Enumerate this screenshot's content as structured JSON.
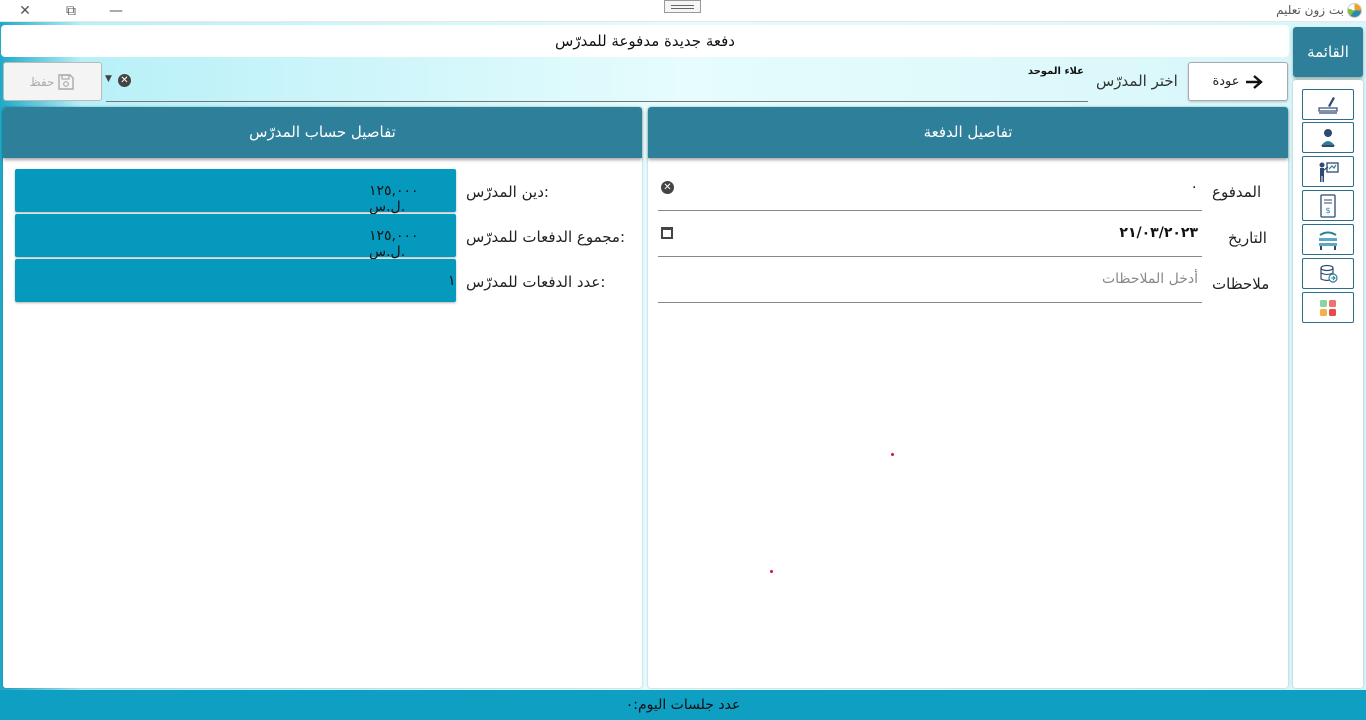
{
  "window": {
    "app_title": "بت زون تعليم",
    "minimize_icon": "minimize-icon",
    "restore_icon": "restore-icon",
    "close_icon": "close-icon"
  },
  "header": {
    "title": "دفعة جديدة مدفوعة للمدرّس"
  },
  "menu": {
    "label": "القائمة"
  },
  "sidebar": {
    "items": [
      {
        "icon": "teacher-writing-icon"
      },
      {
        "icon": "student-icon"
      },
      {
        "icon": "teacher-board-icon"
      },
      {
        "icon": "invoice-icon"
      },
      {
        "icon": "classroom-icon"
      },
      {
        "icon": "database-icon"
      },
      {
        "icon": "apps-grid-icon"
      }
    ]
  },
  "toolbar": {
    "back_label": "عودة",
    "teacher_label": "اختر المدرّس",
    "teacher_value": "علاء الموحد",
    "save_label": "حفظ"
  },
  "payment": {
    "title": "تفاصيل الدفعة",
    "paid_label": "المدفوع",
    "paid_value": "٠",
    "date_label": "التاريخ",
    "date_value": "٢١/٠٣/٢٠٢٣",
    "notes_label": "ملاحظات",
    "notes_placeholder": "أدخل الملاحظات"
  },
  "account": {
    "title": "تفاصيل حساب المدرّس",
    "debt_label": "دين المدرّس:",
    "debt_value": "١٢٥,٠٠٠ ل.س.",
    "total_label": "مجموع الدفعات للمدرّس:",
    "total_value": "١٢٥,٠٠٠ ل.س.",
    "count_label": "عدد الدفعات للمدرّس:",
    "count_value": "١"
  },
  "footer": {
    "sessions_today": "عدد جلسات اليوم:٠"
  },
  "colors": {
    "primary": "#2e7f9a",
    "accent": "#0599bd",
    "footer": "#0e9fc2"
  }
}
